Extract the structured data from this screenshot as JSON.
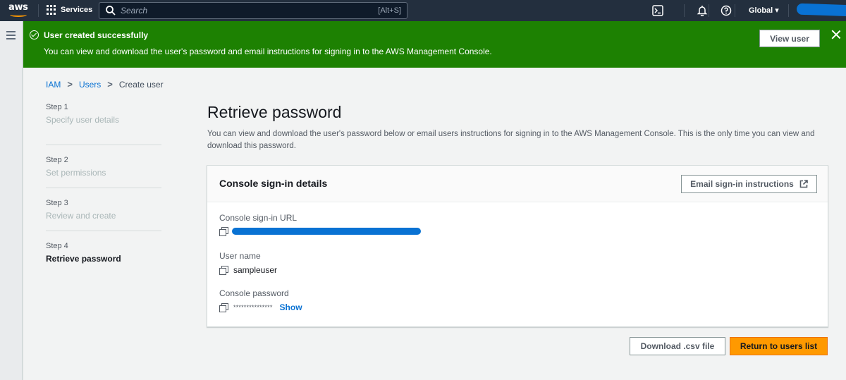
{
  "topnav": {
    "logo_text": "aws",
    "services_label": "Services",
    "search_placeholder": "Search",
    "search_shortcut": "[Alt+S]",
    "region_label": "Global ▾",
    "icons": [
      "cloudshell-icon",
      "bell-icon",
      "help-icon"
    ]
  },
  "flash": {
    "title": "User created successfully",
    "message": "You can view and download the user's password and email instructions for signing in to the AWS Management Console.",
    "view_button": "View user",
    "color": "#1d8102"
  },
  "breadcrumb": [
    {
      "label": "IAM",
      "link": true
    },
    {
      "label": "Users",
      "link": true
    },
    {
      "label": "Create user",
      "link": false
    }
  ],
  "breadcrumb_separator": ">",
  "steps": [
    {
      "number": "Step 1",
      "name": "Specify user details",
      "active": false
    },
    {
      "number": "Step 2",
      "name": "Set permissions",
      "active": false
    },
    {
      "number": "Step 3",
      "name": "Review and create",
      "active": false
    },
    {
      "number": "Step 4",
      "name": "Retrieve password",
      "active": true
    }
  ],
  "main": {
    "title": "Retrieve password",
    "description": "You can view and download the user's password below or email users instructions for signing in to the AWS Management Console. This is the only time you can view and download this password."
  },
  "card": {
    "title": "Console sign-in details",
    "email_button": "Email sign-in instructions",
    "fields": {
      "url": {
        "label": "Console sign-in URL",
        "value_redacted": true
      },
      "username": {
        "label": "User name",
        "value": "sampleuser"
      },
      "password": {
        "label": "Console password",
        "value": "***************",
        "show_link": "Show"
      }
    }
  },
  "actions": {
    "download": "Download .csv file",
    "return": "Return to users list"
  },
  "colors": {
    "nav_bg": "#232f3e",
    "primary_button": "#ff9900",
    "link": "#0972d3",
    "success": "#1d8102"
  }
}
